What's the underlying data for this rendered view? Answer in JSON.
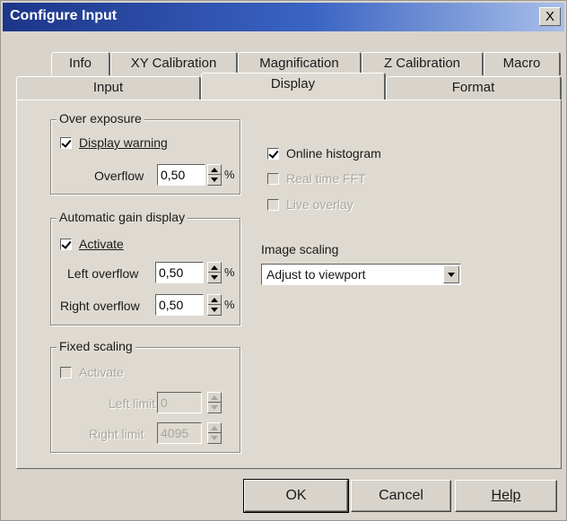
{
  "window": {
    "title": "Configure Input",
    "close_label": "X"
  },
  "tabs_back": [
    "Info",
    "XY Calibration",
    "Magnification",
    "Z Calibration",
    "Macro"
  ],
  "tabs_front": [
    "Input",
    "Display",
    "Format"
  ],
  "active_tab": "Display",
  "over_exposure": {
    "title": "Over exposure",
    "display_warning": {
      "label": "Display warning",
      "checked": true
    },
    "overflow_label": "Overflow",
    "overflow_value": "0,50",
    "unit": "%"
  },
  "auto_gain": {
    "title": "Automatic gain display",
    "activate": {
      "label": "Activate",
      "checked": true
    },
    "left_overflow_label": "Left overflow",
    "left_overflow_value": "0,50",
    "right_overflow_label": "Right overflow",
    "right_overflow_value": "0,50",
    "unit": "%"
  },
  "fixed_scaling": {
    "title": "Fixed scaling",
    "activate": {
      "label": "Activate",
      "checked": false,
      "enabled": false
    },
    "left_limit_label": "Left limit",
    "left_limit_value": "0",
    "right_limit_label": "Right limit",
    "right_limit_value": "4095"
  },
  "options": {
    "online_histogram": {
      "label": "Online histogram",
      "checked": true,
      "enabled": true
    },
    "real_time_fft": {
      "label": "Real time FFT",
      "checked": false,
      "enabled": false
    },
    "live_overlay": {
      "label": "Live overlay",
      "checked": false,
      "enabled": false
    }
  },
  "image_scaling": {
    "label": "Image scaling",
    "selected": "Adjust to viewport"
  },
  "buttons": {
    "ok": "OK",
    "cancel": "Cancel",
    "help": "Help"
  },
  "colors": {
    "title_start": "#1c3588",
    "title_end": "#a9bfe8",
    "face": "#d8d4cc"
  }
}
